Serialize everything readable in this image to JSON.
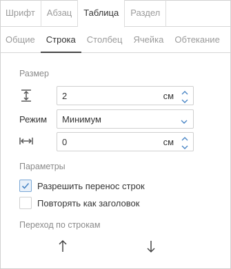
{
  "top_tabs": [
    {
      "label": "Шрифт",
      "active": false
    },
    {
      "label": "Абзац",
      "active": false
    },
    {
      "label": "Таблица",
      "active": true
    },
    {
      "label": "Раздел",
      "active": false
    }
  ],
  "sub_tabs": [
    {
      "label": "Общие",
      "active": false
    },
    {
      "label": "Строка",
      "active": true
    },
    {
      "label": "Столбец",
      "active": false
    },
    {
      "label": "Ячейка",
      "active": false
    },
    {
      "label": "Обтекание",
      "active": false
    }
  ],
  "size": {
    "title": "Размер",
    "height": {
      "value": "2",
      "unit": "см",
      "icon": "row-height-icon"
    },
    "mode": {
      "label": "Режим",
      "value": "Минимум"
    },
    "width": {
      "value": "0",
      "unit": "см",
      "icon": "horizontal-resize-icon"
    }
  },
  "params": {
    "title": "Параметры",
    "allow_break": {
      "label": "Разрешить перенос строк",
      "checked": true
    },
    "repeat_header": {
      "label": "Повторять как заголовок",
      "checked": false
    }
  },
  "navigation": {
    "title": "Переход по строкам",
    "up_icon": "arrow-up-icon",
    "down_icon": "arrow-down-icon"
  },
  "colors": {
    "accent": "#4a86c5",
    "muted": "#9a9a9a"
  }
}
